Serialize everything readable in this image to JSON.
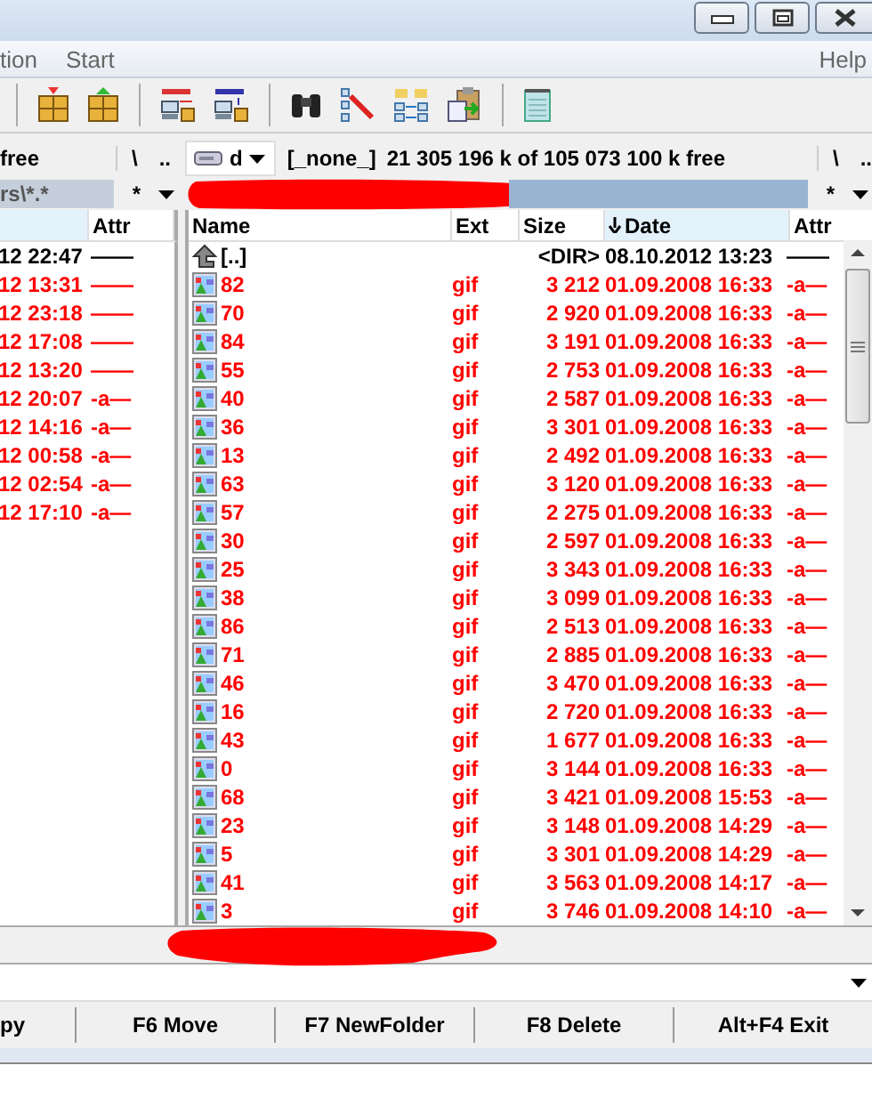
{
  "menu": {
    "items": [
      {
        "label": "tion"
      },
      {
        "label": "Start"
      },
      {
        "label": "Help"
      }
    ]
  },
  "left_panel": {
    "drive_info": "free",
    "nav": [
      "\\",
      ".."
    ],
    "path": "rs\\*.*",
    "filter": "*",
    "columns": [
      {
        "label": "Attr"
      }
    ],
    "rows": [
      {
        "kind": "folder",
        "column_1": "12 22:47",
        "attr": "——"
      },
      {
        "kind": "file",
        "column_1": "12 13:31",
        "attr": "——"
      },
      {
        "kind": "file",
        "column_1": "12 23:18",
        "attr": "——"
      },
      {
        "kind": "file",
        "column_1": "12 17:08",
        "attr": "——"
      },
      {
        "kind": "file",
        "column_1": "12 13:20",
        "attr": "——"
      },
      {
        "kind": "file",
        "column_1": "12 20:07",
        "attr": "-a—"
      },
      {
        "kind": "file",
        "column_1": "12 14:16",
        "attr": "-a—"
      },
      {
        "kind": "file",
        "column_1": "12 00:58",
        "attr": "-a—"
      },
      {
        "kind": "file",
        "column_1": "12 02:54",
        "attr": "-a—"
      },
      {
        "kind": "file",
        "column_1": "12 17:10",
        "attr": "-a—"
      }
    ]
  },
  "right_panel": {
    "drive": "d",
    "volume": "[_none_]",
    "drive_info": "21 305 196 k of 105 073 100 k free",
    "nav": [
      "\\",
      ".."
    ],
    "filter": "*",
    "columns": [
      {
        "label": "Name",
        "sorted": false
      },
      {
        "label": "Ext",
        "sorted": false
      },
      {
        "label": "Size",
        "sorted": false
      },
      {
        "label": "Date",
        "sorted": true
      },
      {
        "label": "Attr",
        "sorted": false
      }
    ],
    "rows": [
      {
        "kind": "up",
        "name": "[..]",
        "ext": "",
        "size": "<DIR>",
        "date": "08.10.2012 13:23",
        "attr": "——"
      },
      {
        "kind": "file",
        "name": "82",
        "ext": "gif",
        "size": "3 212",
        "date": "01.09.2008 16:33",
        "attr": "-a—"
      },
      {
        "kind": "file",
        "name": "70",
        "ext": "gif",
        "size": "2 920",
        "date": "01.09.2008 16:33",
        "attr": "-a—"
      },
      {
        "kind": "file",
        "name": "84",
        "ext": "gif",
        "size": "3 191",
        "date": "01.09.2008 16:33",
        "attr": "-a—"
      },
      {
        "kind": "file",
        "name": "55",
        "ext": "gif",
        "size": "2 753",
        "date": "01.09.2008 16:33",
        "attr": "-a—"
      },
      {
        "kind": "file",
        "name": "40",
        "ext": "gif",
        "size": "2 587",
        "date": "01.09.2008 16:33",
        "attr": "-a—"
      },
      {
        "kind": "file",
        "name": "36",
        "ext": "gif",
        "size": "3 301",
        "date": "01.09.2008 16:33",
        "attr": "-a—"
      },
      {
        "kind": "file",
        "name": "13",
        "ext": "gif",
        "size": "2 492",
        "date": "01.09.2008 16:33",
        "attr": "-a—"
      },
      {
        "kind": "file",
        "name": "63",
        "ext": "gif",
        "size": "3 120",
        "date": "01.09.2008 16:33",
        "attr": "-a—"
      },
      {
        "kind": "file",
        "name": "57",
        "ext": "gif",
        "size": "2 275",
        "date": "01.09.2008 16:33",
        "attr": "-a—"
      },
      {
        "kind": "file",
        "name": "30",
        "ext": "gif",
        "size": "2 597",
        "date": "01.09.2008 16:33",
        "attr": "-a—"
      },
      {
        "kind": "file",
        "name": "25",
        "ext": "gif",
        "size": "3 343",
        "date": "01.09.2008 16:33",
        "attr": "-a—"
      },
      {
        "kind": "file",
        "name": "38",
        "ext": "gif",
        "size": "3 099",
        "date": "01.09.2008 16:33",
        "attr": "-a—"
      },
      {
        "kind": "file",
        "name": "86",
        "ext": "gif",
        "size": "2 513",
        "date": "01.09.2008 16:33",
        "attr": "-a—"
      },
      {
        "kind": "file",
        "name": "71",
        "ext": "gif",
        "size": "2 885",
        "date": "01.09.2008 16:33",
        "attr": "-a—"
      },
      {
        "kind": "file",
        "name": "46",
        "ext": "gif",
        "size": "3 470",
        "date": "01.09.2008 16:33",
        "attr": "-a—"
      },
      {
        "kind": "file",
        "name": "16",
        "ext": "gif",
        "size": "2 720",
        "date": "01.09.2008 16:33",
        "attr": "-a—"
      },
      {
        "kind": "file",
        "name": "43",
        "ext": "gif",
        "size": "1 677",
        "date": "01.09.2008 16:33",
        "attr": "-a—"
      },
      {
        "kind": "file",
        "name": "0",
        "ext": "gif",
        "size": "3 144",
        "date": "01.09.2008 16:33",
        "attr": "-a—"
      },
      {
        "kind": "file",
        "name": "68",
        "ext": "gif",
        "size": "3 421",
        "date": "01.09.2008 15:53",
        "attr": "-a—"
      },
      {
        "kind": "file",
        "name": "23",
        "ext": "gif",
        "size": "3 148",
        "date": "01.09.2008 14:29",
        "attr": "-a—"
      },
      {
        "kind": "file",
        "name": "5",
        "ext": "gif",
        "size": "3 301",
        "date": "01.09.2008 14:29",
        "attr": "-a—"
      },
      {
        "kind": "file",
        "name": "41",
        "ext": "gif",
        "size": "3 563",
        "date": "01.09.2008 14:17",
        "attr": "-a—"
      },
      {
        "kind": "file",
        "name": "3",
        "ext": "gif",
        "size": "3 746",
        "date": "01.09.2008 14:10",
        "attr": "-a—"
      }
    ]
  },
  "function_keys": [
    "py",
    "F6 Move",
    "F7 NewFolder",
    "F8 Delete",
    "Alt+F4 Exit"
  ]
}
